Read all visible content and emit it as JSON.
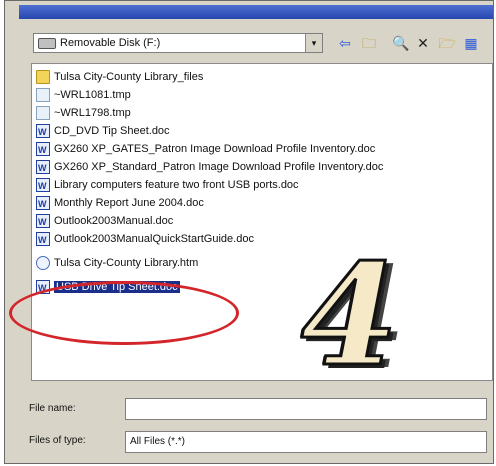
{
  "lookin": {
    "value": "Removable Disk (F:)",
    "arrow": "▾"
  },
  "toolbar": {
    "back": "⇦",
    "up": "🗀",
    "search": "🔍",
    "delete": "✕",
    "newfolder": "🗁",
    "views": "▦"
  },
  "files": [
    {
      "name": "Tulsa City-County Library_files",
      "type": "folder"
    },
    {
      "name": "~WRL1081.tmp",
      "type": "tmp"
    },
    {
      "name": "~WRL1798.tmp",
      "type": "tmp"
    },
    {
      "name": "CD_DVD Tip Sheet.doc",
      "type": "doc"
    },
    {
      "name": "GX260 XP_GATES_Patron Image Download Profile Inventory.doc",
      "type": "doc"
    },
    {
      "name": "GX260 XP_Standard_Patron Image Download Profile Inventory.doc",
      "type": "doc"
    },
    {
      "name": "Library computers feature two front USB ports.doc",
      "type": "doc"
    },
    {
      "name": "Monthly Report June 2004.doc",
      "type": "doc"
    },
    {
      "name": "Outlook2003Manual.doc",
      "type": "doc"
    },
    {
      "name": "Outlook2003ManualQuickStartGuide.doc",
      "type": "doc"
    },
    {
      "name": "Tulsa City-County Library.htm",
      "type": "htm"
    },
    {
      "name": "USB Drive Tip Sheet.doc",
      "type": "doc",
      "selected": true
    }
  ],
  "step_number": "4",
  "annotation_color": "#d4262a",
  "filename": {
    "label": "File name:",
    "value": ""
  },
  "filetype": {
    "label": "Files of type:",
    "value": "All Files (*.*)"
  }
}
